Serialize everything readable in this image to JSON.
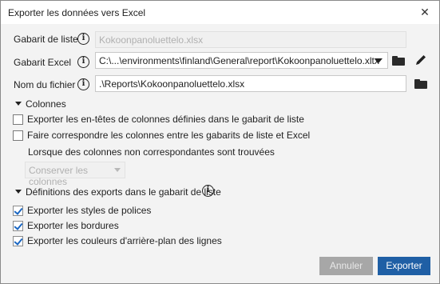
{
  "window": {
    "title": "Exporter les données vers Excel",
    "close_glyph": "✕"
  },
  "fields": {
    "gabarit_liste": {
      "label": "Gabarit de liste",
      "value": "Kokoonpanoluettelo.xlsx"
    },
    "gabarit_excel": {
      "label": "Gabarit Excel",
      "value": "C:\\...\\environments\\finland\\General\\report\\Kokoonpanoluettelo.xltx"
    },
    "nom_fichier": {
      "label": "Nom du fichier",
      "value": ".\\Reports\\Kokoonpanoluettelo.xlsx"
    }
  },
  "info_glyph": "i",
  "colonnes": {
    "heading": "Colonnes",
    "items": [
      {
        "label": "Exporter les en-têtes de colonnes définies dans le gabarit de liste",
        "checked": false
      },
      {
        "label": "Faire correspondre les colonnes entre les gabarits de liste et Excel",
        "checked": false
      }
    ],
    "mismatch_label": "Lorsque des colonnes non correspondantes sont trouvées",
    "mismatch_select": "Conserver les colonnes"
  },
  "definitions": {
    "heading": "Définitions des exports dans le gabarit de liste",
    "items": [
      {
        "label": "Exporter les styles de polices",
        "checked": true
      },
      {
        "label": "Exporter les bordures",
        "checked": true
      },
      {
        "label": "Exporter les couleurs d'arrière-plan des lignes",
        "checked": true
      }
    ]
  },
  "buttons": {
    "cancel": "Annuler",
    "export": "Exporter"
  },
  "colors": {
    "accent": "#1f5fa5",
    "check": "#1a66c2",
    "disabled_button": "#a7a7a7"
  }
}
